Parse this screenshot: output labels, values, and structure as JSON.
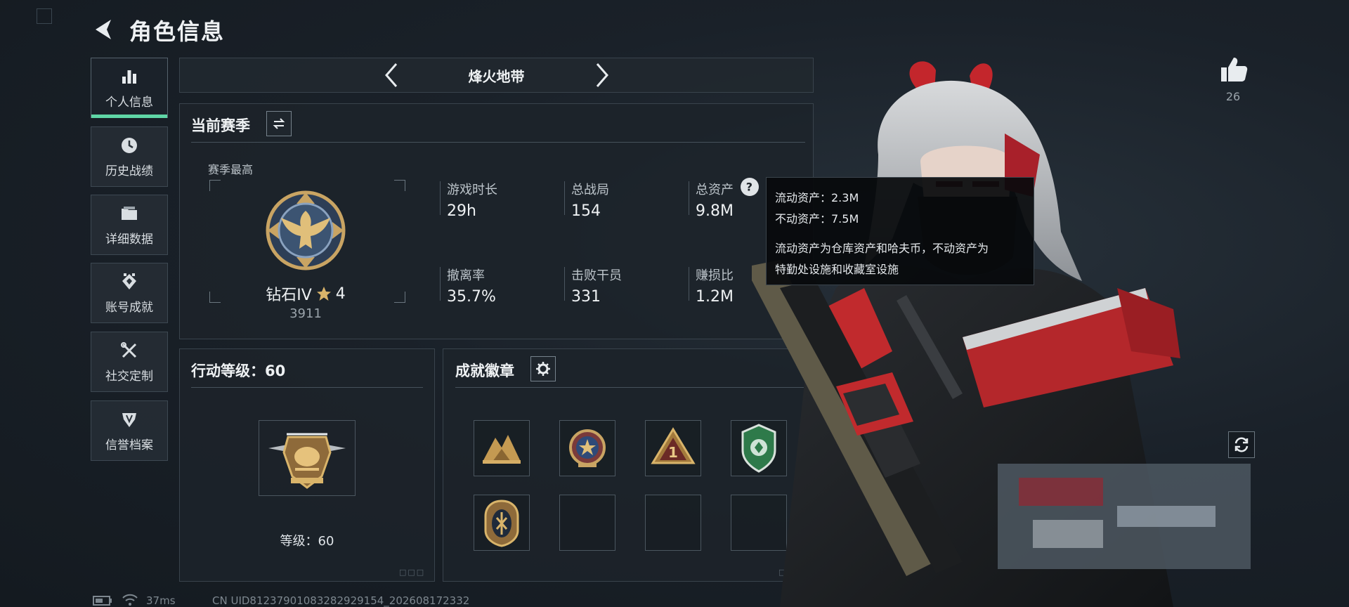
{
  "header": {
    "title": "角色信息"
  },
  "sidebar": {
    "items": [
      {
        "label": "个人信息",
        "icon": "bar-chart-icon",
        "active": true
      },
      {
        "label": "历史战绩",
        "icon": "clock-icon"
      },
      {
        "label": "详细数据",
        "icon": "folder-icon"
      },
      {
        "label": "账号成就",
        "icon": "achievement-icon"
      },
      {
        "label": "社交定制",
        "icon": "tools-icon"
      },
      {
        "label": "信誉档案",
        "icon": "shield-icon"
      }
    ]
  },
  "mode": {
    "title": "烽火地带"
  },
  "season": {
    "title": "当前赛季",
    "best_label": "赛季最高",
    "rank_name": "钻石IV",
    "rank_stars": "4",
    "rank_points": "3911",
    "stats": [
      {
        "label": "游戏时长",
        "value": "29h"
      },
      {
        "label": "总战局",
        "value": "154"
      },
      {
        "label": "总资产",
        "value": "9.8M"
      },
      {
        "label": "撤离率",
        "value": "35.7%"
      },
      {
        "label": "击败干员",
        "value": "331"
      },
      {
        "label": "赚损比",
        "value": "1.2M"
      }
    ]
  },
  "tooltip": {
    "liquid": "流动资产：2.3M",
    "fixed": "不动资产：7.5M",
    "desc_line1": "流动资产为仓库资产和哈夫币，不动资产为",
    "desc_line2": "特勤处设施和收藏室设施"
  },
  "action": {
    "title": "行动等级：60",
    "level_text": "等级：60"
  },
  "badges": {
    "title": "成就徽章",
    "items": [
      {
        "icon": "mountain-badge-icon",
        "empty": false
      },
      {
        "icon": "star-crest-badge-icon",
        "empty": false
      },
      {
        "icon": "number-one-triangle-badge-icon",
        "empty": false
      },
      {
        "icon": "green-shield-badge-icon",
        "empty": false
      },
      {
        "icon": "shield-emblem-badge-icon",
        "empty": false
      },
      {
        "empty": true
      },
      {
        "empty": true
      },
      {
        "empty": true
      }
    ]
  },
  "like": {
    "count": "26"
  },
  "status": {
    "ping": "37ms",
    "uid": "CN UID8123790108328292915​4_202608172332"
  },
  "colors": {
    "accent": "#5fd6a6",
    "gold": "#c9a463",
    "panel": "#1c232a"
  }
}
